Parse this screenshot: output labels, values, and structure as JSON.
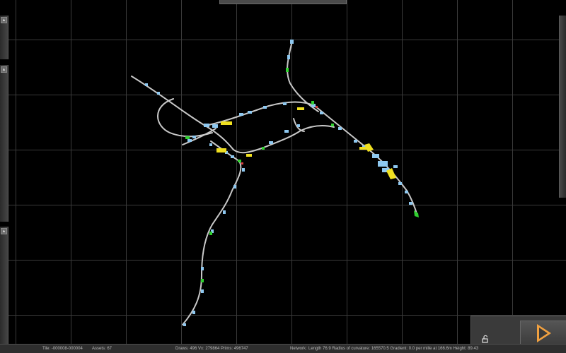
{
  "status": {
    "tile": "Tile: -000008-000004",
    "assets": "Assets: 67",
    "draws": "Draws: 496 Vx: 279864 Prims: 496747",
    "network_label": "Network:",
    "length": "Length 76.9 Radius of curvature: 165570.5 Gradient: 0.0 per mille at 166.6m Height: 89.43"
  },
  "side_panels": [
    {
      "name": "upper",
      "pin": "▴"
    },
    {
      "name": "middle",
      "pin": "▴"
    },
    {
      "name": "lower",
      "pin": "▴"
    }
  ],
  "controls": {
    "lock_icon": "padlock-open-icon",
    "play_icon": "play-triangle-icon"
  },
  "colors": {
    "track": "#c8c8c8",
    "marker_blue": "#8ec8f0",
    "marker_yellow": "#f0e020",
    "marker_green": "#30d030",
    "play_orange": "#f0a040"
  }
}
